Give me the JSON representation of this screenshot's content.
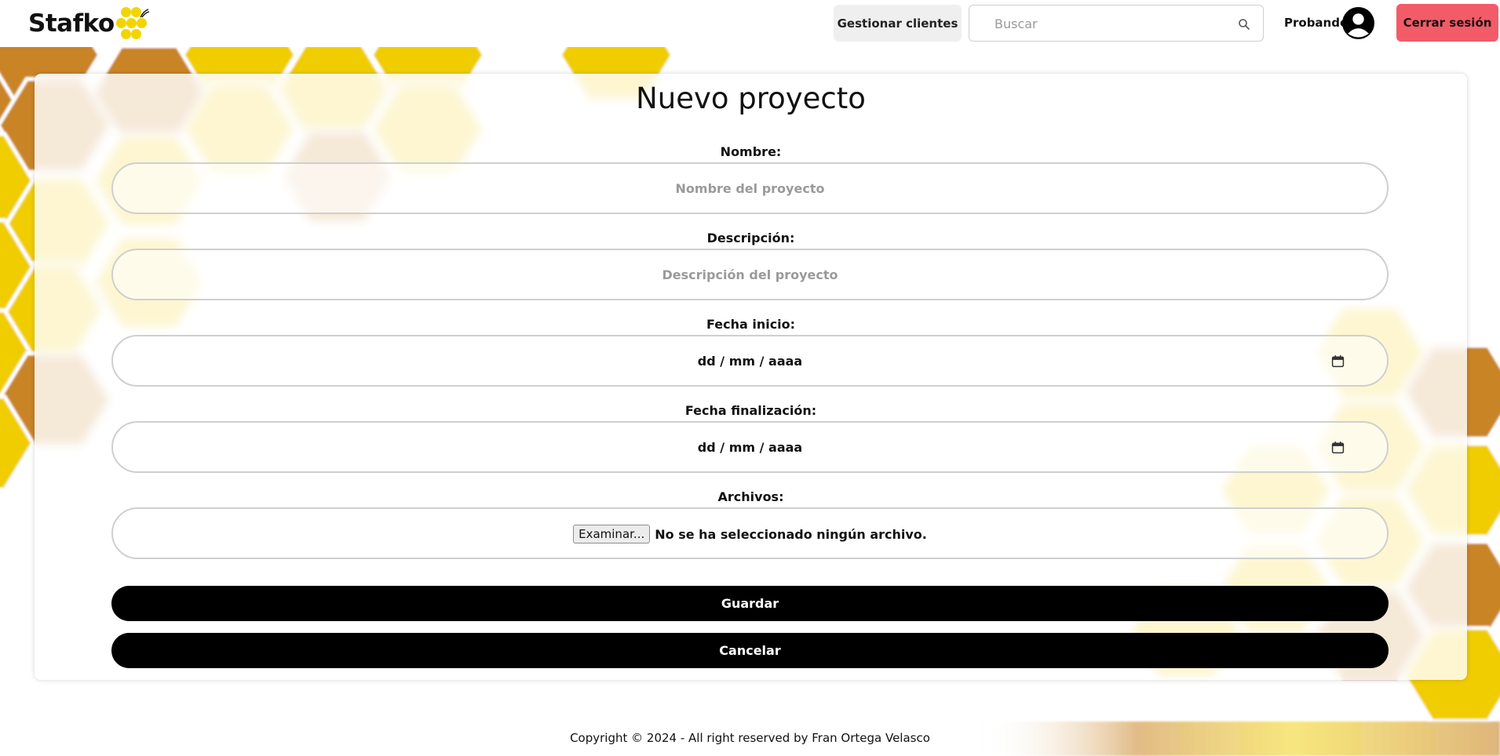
{
  "header": {
    "logo_text": "Stafko",
    "manage_clients_label": "Gestionar clientes",
    "search_placeholder": "Buscar",
    "user_name": "Probando",
    "logout_label": "Cerrar sesión"
  },
  "form": {
    "title": "Nuevo proyecto",
    "name": {
      "label": "Nombre:",
      "placeholder": "Nombre del proyecto"
    },
    "description": {
      "label": "Descripción:",
      "placeholder": "Descripción del proyecto"
    },
    "start_date": {
      "label": "Fecha inicio:",
      "value": "dd / mm / aaaa"
    },
    "end_date": {
      "label": "Fecha finalización:",
      "value": "dd / mm / aaaa"
    },
    "files": {
      "label": "Archivos:",
      "button_label": "Examinar...",
      "status": "No se ha seleccionado ningún archivo."
    },
    "save_label": "Guardar",
    "cancel_label": "Cancelar"
  },
  "footer": {
    "copyright": "Copyright © 2024 - All right reserved by Fran Ortega Velasco"
  },
  "colors": {
    "honey_yellow": "#f0cd00",
    "honey_brown": "#c98425",
    "logout_red": "#f45b69",
    "action_black": "#000000"
  }
}
